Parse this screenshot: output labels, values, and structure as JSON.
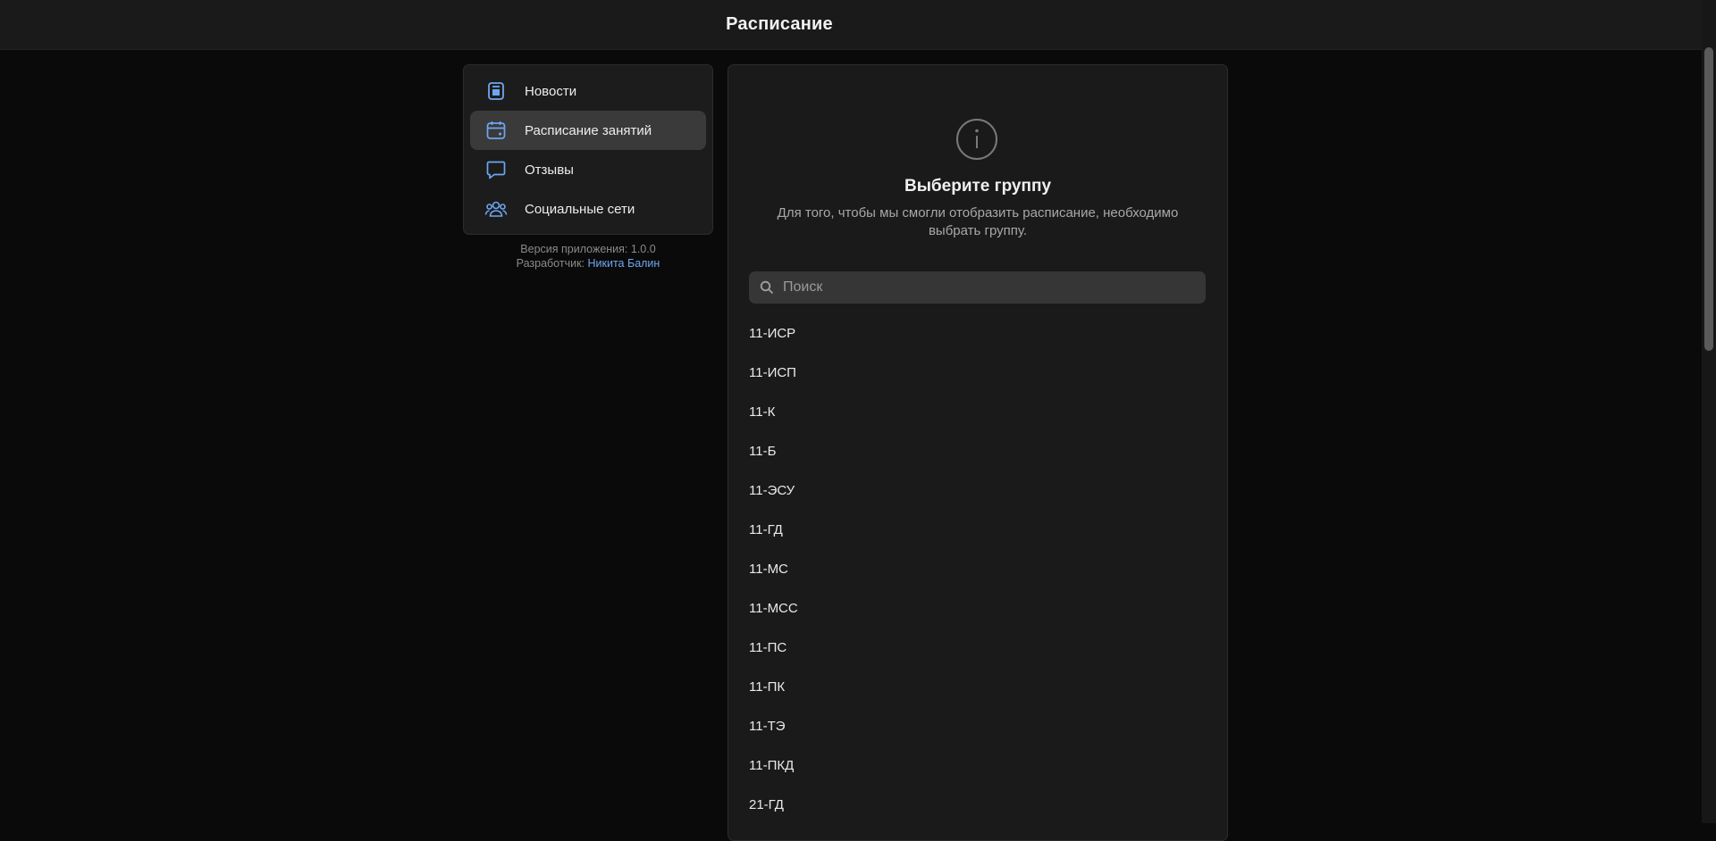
{
  "header": {
    "title": "Расписание"
  },
  "sidebar": {
    "items": [
      {
        "label": "Новости",
        "icon": "news-icon"
      },
      {
        "label": "Расписание занятий",
        "icon": "calendar-icon",
        "active": true
      },
      {
        "label": "Отзывы",
        "icon": "chat-bubble-icon"
      },
      {
        "label": "Социальные сети",
        "icon": "users-icon"
      }
    ]
  },
  "meta": {
    "version_text": "Версия приложения: 1.0.0",
    "developer_prefix": "Разработчик:",
    "developer_name": "Никита Балин"
  },
  "main": {
    "title": "Выберите группу",
    "description": "Для того, чтобы мы смогли отобразить расписание, необходимо выбрать группу.",
    "search_placeholder": "Поиск",
    "groups": [
      "11-ИСР",
      "11-ИСП",
      "11-К",
      "11-Б",
      "11-ЭСУ",
      "11-ГД",
      "11-МС",
      "11-МСС",
      "11-ПС",
      "11-ПК",
      "11-ТЭ",
      "11-ПКД",
      "21-ГД"
    ]
  },
  "colors": {
    "background": "#0a0a0a",
    "panel": "#1a1a1a",
    "active_item": "#3a3a3a",
    "icon_accent": "#6ea6f0",
    "link": "#6ea6f0"
  }
}
